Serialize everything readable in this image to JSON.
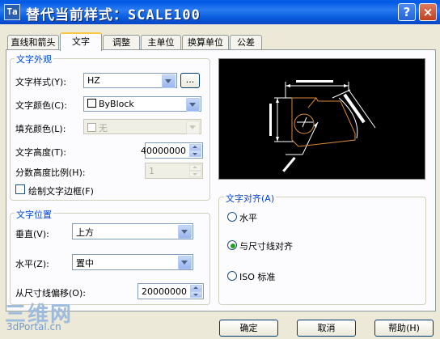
{
  "window": {
    "icon": "Ta",
    "title": "替代当前样式：SCALE100",
    "help": "?",
    "close": "×"
  },
  "tabs": [
    {
      "label": "直线和箭头"
    },
    {
      "label": "文字"
    },
    {
      "label": "调整"
    },
    {
      "label": "主单位"
    },
    {
      "label": "换算单位"
    },
    {
      "label": "公差"
    }
  ],
  "appearance": {
    "legend": "文字外观",
    "style_label": "文字样式",
    "style_key": "(Y):",
    "style_value": "HZ",
    "browse": "...",
    "color_label": "文字颜色",
    "color_key": "(C):",
    "color_value": "ByBlock",
    "fill_label": "填充颜色",
    "fill_key": "(L):",
    "fill_value": "无",
    "height_label": "文字高度",
    "height_key": "(T):",
    "height_value": "40000000",
    "fraction_label": "分数高度比例",
    "fraction_key": "(H):",
    "fraction_value": "1",
    "frame_label": "绘制文字边框",
    "frame_key": "(F)"
  },
  "placement": {
    "legend": "文字位置",
    "vertical_label": "垂直",
    "vertical_key": "(V):",
    "vertical_value": "上方",
    "horizontal_label": "水平",
    "horizontal_key": "(Z):",
    "horizontal_value": "置中",
    "offset_label": "从尺寸线偏移",
    "offset_key": "(O):",
    "offset_value": "20000000"
  },
  "alignment": {
    "legend": "文字对齐",
    "legend_key": "(A)",
    "options": [
      {
        "label": "水平",
        "checked": false
      },
      {
        "label": "与尺寸线对齐",
        "checked": true
      },
      {
        "label": "ISO 标准",
        "checked": false
      }
    ]
  },
  "buttons": {
    "ok": "确定",
    "cancel": "取消",
    "help": "帮助",
    "help_key": "(H)"
  },
  "watermark": {
    "logo": "三维网",
    "site": "3dPortal.cn"
  },
  "colors": {
    "title_bar": "#0a5fe0",
    "active_tab": "#ffc83c",
    "legend": "#0046d5",
    "preview_bg": "#000000",
    "preview_lines": "#ffffff",
    "preview_part": "#d98a3b"
  },
  "icons": {
    "help": "question-icon",
    "close": "close-icon"
  }
}
